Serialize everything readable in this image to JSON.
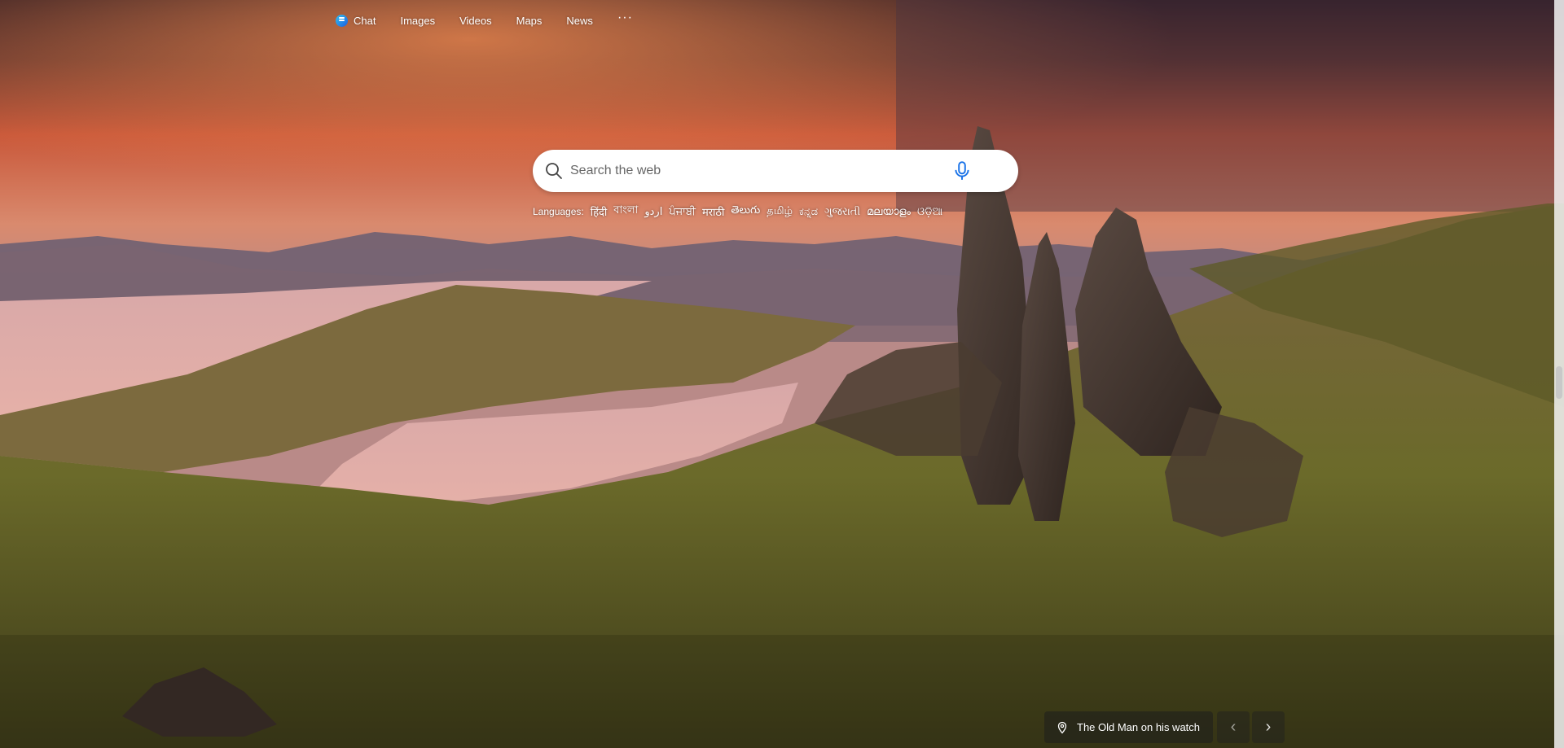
{
  "nav": {
    "items": [
      {
        "label": "Chat"
      },
      {
        "label": "Images"
      },
      {
        "label": "Videos"
      },
      {
        "label": "Maps"
      },
      {
        "label": "News"
      }
    ],
    "more_label": "···"
  },
  "search": {
    "placeholder": "Search the web"
  },
  "languages": {
    "label": "Languages:",
    "items": [
      "हिंदी",
      "বাংলা",
      "اردو",
      "ਪੰਜਾਬੀ",
      "मराठी",
      "తెలుగు",
      "தமிழ்",
      "ಕನ್ನಡ",
      "ગુજરાતી",
      "മലയാളം",
      "ଓଡ଼ିଆ"
    ]
  },
  "image_info": {
    "title": "The Old Man on his watch"
  },
  "arrows": {
    "prev": "‹",
    "next": "›"
  },
  "colors": {
    "accent": "#1a5fe0",
    "mic": "#1a73e8"
  }
}
